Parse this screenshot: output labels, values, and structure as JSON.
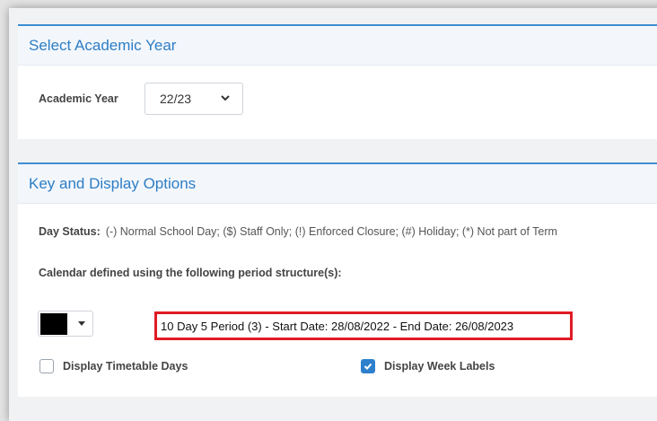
{
  "academic_year_panel": {
    "title": "Select Academic Year",
    "label": "Academic Year",
    "selected_value": "22/23"
  },
  "key_panel": {
    "title": "Key and Display Options",
    "day_status_label": "Day Status:",
    "day_status_text": "(-) Normal School Day; ($) Staff Only; (!) Enforced Closure; (#) Holiday; (*) Not part of Term",
    "defined_text": "Calendar defined using the following period structure(s):",
    "period_structure_text": "10 Day 5 Period (3) - Start Date: 28/08/2022 - End Date: 26/08/2023",
    "swatch_color": "#000000",
    "highlight_color": "#e01b24",
    "checkboxes": {
      "timetable_days": {
        "label": "Display Timetable Days",
        "checked": false
      },
      "week_labels": {
        "label": "Display Week Labels",
        "checked": true
      }
    }
  },
  "accent_color": "#2e7dc4"
}
